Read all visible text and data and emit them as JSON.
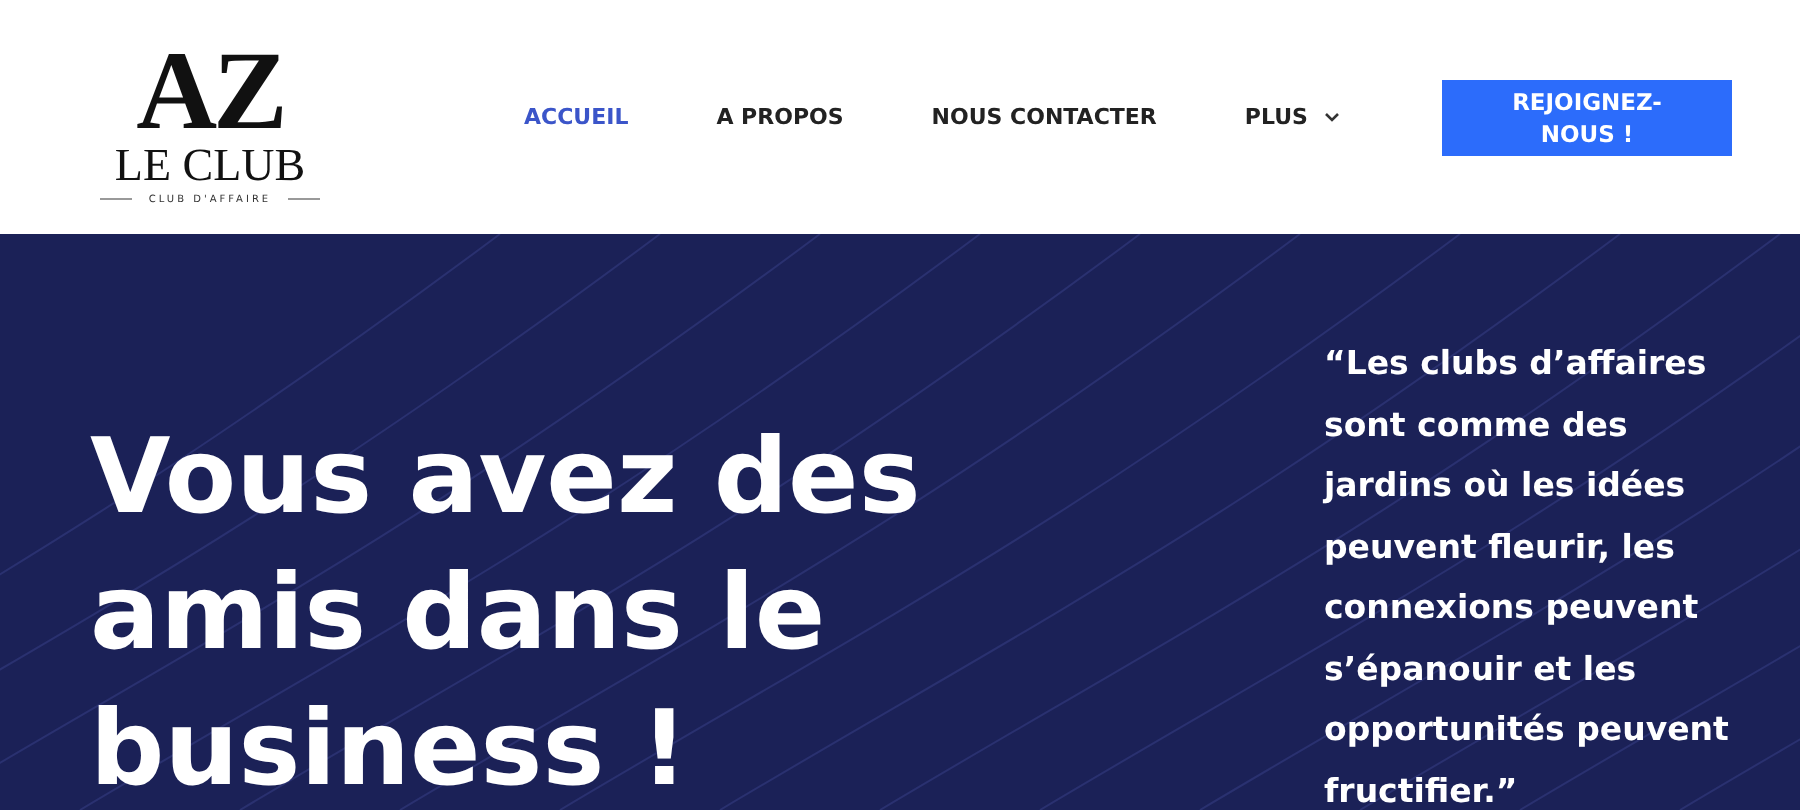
{
  "logo": {
    "mark": "AZ",
    "name": "LE CLUB",
    "tagline": "CLUB D'AFFAIRE"
  },
  "nav": [
    {
      "label": "ACCUEIL",
      "selected": true,
      "dropdown": false
    },
    {
      "label": "A PROPOS",
      "selected": false,
      "dropdown": false
    },
    {
      "label": "NOUS CONTACTER",
      "selected": false,
      "dropdown": false
    },
    {
      "label": "PLUS",
      "selected": false,
      "dropdown": true
    }
  ],
  "cta_button": "REJOIGNEZ-NOUS !",
  "hero": {
    "headline": "Vous avez des amis dans le business !",
    "quote": "“Les clubs d’affaires sont comme des jardins où les idées peuvent fleurir, les connexions peuvent s’épanouir et les opportunités peuvent fructifier.”"
  }
}
